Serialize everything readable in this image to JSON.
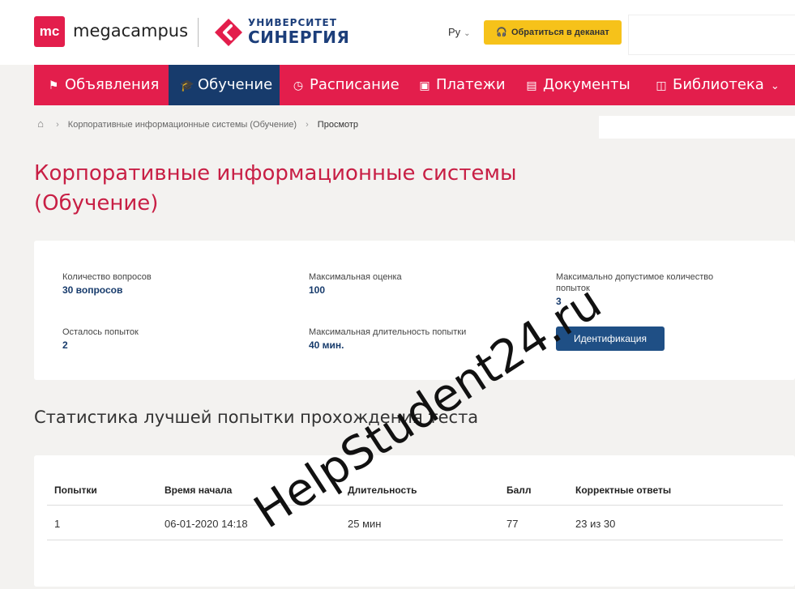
{
  "header": {
    "mc_logo": "mc",
    "brand": "megacampus",
    "university_line1": "УНИВЕРСИТЕТ",
    "university_line2": "СИНЕРГИЯ",
    "lang": "Ру",
    "dean_button": "Обратиться в деканат"
  },
  "nav": {
    "items": [
      {
        "label": "Объявления",
        "icon": "megaphone-icon"
      },
      {
        "label": "Обучение",
        "icon": "graduation-cap-icon"
      },
      {
        "label": "Расписание",
        "icon": "clock-icon"
      },
      {
        "label": "Платежи",
        "icon": "money-icon"
      },
      {
        "label": "Документы",
        "icon": "document-icon"
      },
      {
        "label": "Библиотека",
        "icon": "book-icon"
      }
    ],
    "active_index": 1
  },
  "breadcrumb": {
    "items": [
      "Корпоративные информационные системы (Обучение)",
      "Просмотр"
    ]
  },
  "page": {
    "title": "Корпоративные информационные системы (Обучение)"
  },
  "info": {
    "questions_label": "Количество вопросов",
    "questions_value": "30 вопросов",
    "max_score_label": "Максимальная оценка",
    "max_score_value": "100",
    "max_attempts_label": "Максимально допустимое количество попыток",
    "max_attempts_value": "3",
    "attempts_left_label": "Осталось попыток",
    "attempts_left_value": "2",
    "max_duration_label": "Максимальная длительность попытки",
    "max_duration_value": "40 мин.",
    "ident_button": "Идентификация"
  },
  "stats": {
    "title": "Статистика лучшей попытки прохождения теста",
    "columns": [
      "Попытки",
      "Время начала",
      "Длительность",
      "Балл",
      "Корректные ответы"
    ],
    "rows": [
      [
        "1",
        "06-01-2020 14:18",
        "25 мин",
        "77",
        "23 из 30"
      ]
    ]
  },
  "watermark": "HelpStudent24.ru",
  "colors": {
    "brand_red": "#e31e4c",
    "title_red": "#c81f45",
    "nav_active": "#173b6c",
    "accent_yellow": "#f6c21a",
    "button_blue": "#1f4f85"
  }
}
